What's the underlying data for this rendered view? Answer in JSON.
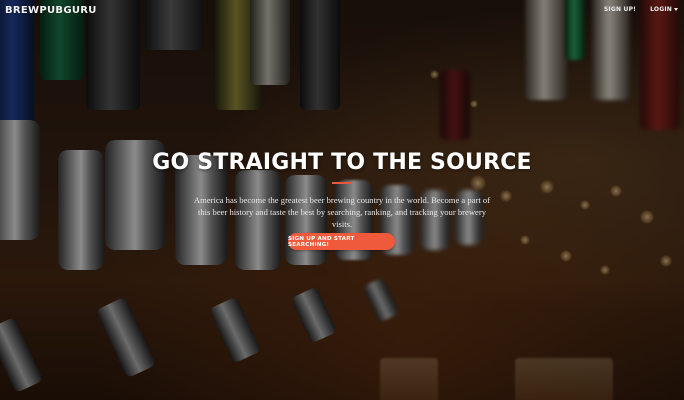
{
  "header": {
    "logo_text": "BREWPUBGURU",
    "nav": {
      "signup_label": "SIGN UP!",
      "login_label": "LOGIN"
    }
  },
  "hero": {
    "title": "GO STRAIGHT TO THE SOURCE",
    "description": "America has become the greatest beer brewing country in the world. Become a part of this beer history and taste the best by searching, ranking, and tracking your brewery visits.",
    "cta_label": "SIGN UP AND START SEARCHING!"
  },
  "colors": {
    "accent": "#ef5a3c",
    "divider": "#e8583e",
    "text": "#ffffff"
  },
  "icons": {
    "login_dropdown": "chevron-down-icon"
  }
}
